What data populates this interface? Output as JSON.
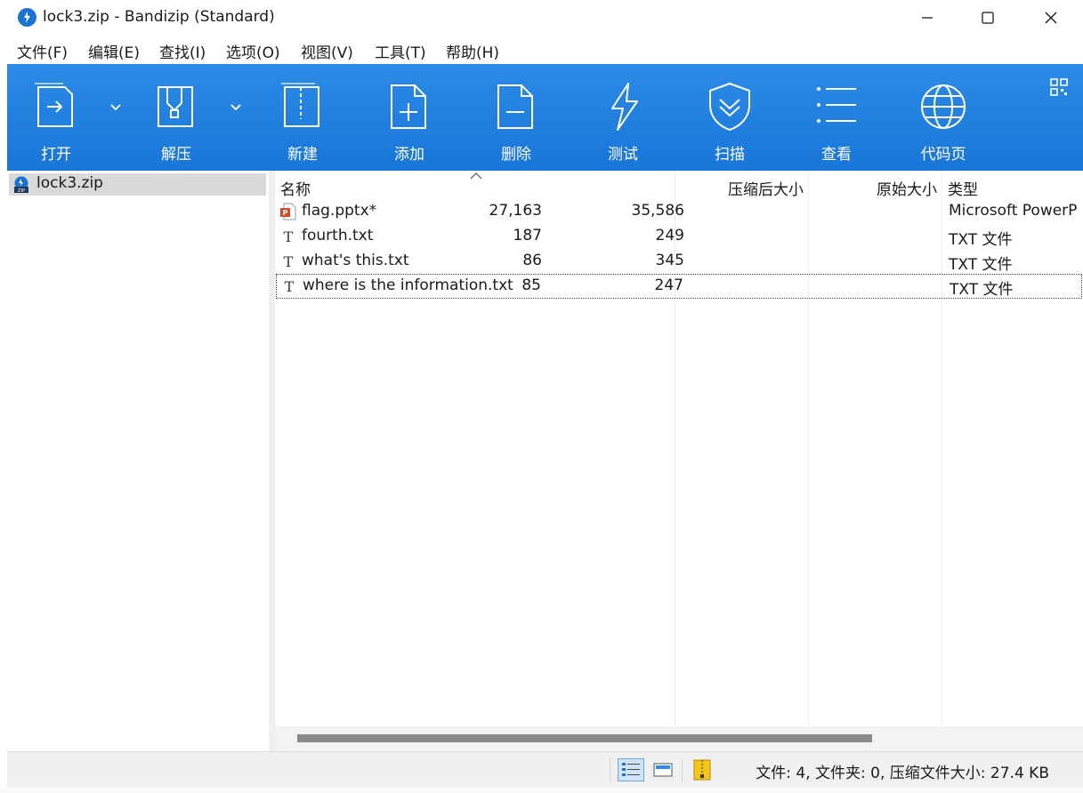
{
  "window": {
    "title": "lock3.zip - Bandizip (Standard)"
  },
  "menu": [
    "文件(F)",
    "编辑(E)",
    "查找(I)",
    "选项(O)",
    "视图(V)",
    "工具(T)",
    "帮助(H)"
  ],
  "toolbar": {
    "open": "打开",
    "extract": "解压",
    "new": "新建",
    "add": "添加",
    "delete": "删除",
    "test": "测试",
    "scan": "扫描",
    "view": "查看",
    "codepage": "代码页"
  },
  "tree": {
    "root": "lock3.zip"
  },
  "columns": {
    "name": "名称",
    "packed": "压缩后大小",
    "original": "原始大小",
    "type": "类型"
  },
  "files": [
    {
      "name": "flag.pptx*",
      "packed": "27,163",
      "original": "35,586",
      "type": "Microsoft PowerP",
      "icon": "pptx-file-icon"
    },
    {
      "name": "fourth.txt",
      "packed": "187",
      "original": "249",
      "type": "TXT 文件",
      "icon": "text-file-icon"
    },
    {
      "name": "what's this.txt",
      "packed": "86",
      "original": "345",
      "type": "TXT 文件",
      "icon": "text-file-icon"
    },
    {
      "name": "where is the information.txt",
      "packed": "85",
      "original": "247",
      "type": "TXT 文件",
      "icon": "text-file-icon"
    }
  ],
  "status": {
    "summary": "文件: 4, 文件夹: 0, 压缩文件大小: 27.4 KB"
  },
  "colors": {
    "toolbar": "#1f80df",
    "selection": "#d9d9d9",
    "pptx": "#d24726"
  }
}
